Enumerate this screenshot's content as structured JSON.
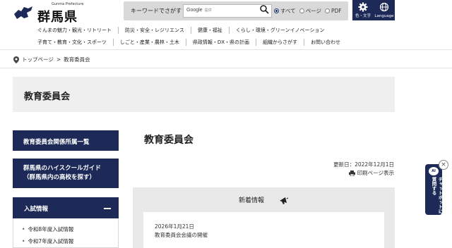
{
  "header": {
    "logo_en": "Gunma Prefecture",
    "logo_jp": "群馬県",
    "search_label": "キーワードでさがす",
    "search_brand": "Google",
    "search_brand_sub": "提供",
    "search_options": [
      "すべて",
      "ページ",
      "PDF"
    ],
    "search_selected": "すべて",
    "util_color_label": "色・文字",
    "util_lang_label": "Language"
  },
  "nav": {
    "row1": [
      "ぐんまの魅力・観光・リトリート",
      "防災・安全・レジリエンス",
      "健康・福祉",
      "くらし・環境・グリーンイノベーション"
    ],
    "row2": [
      "子育て・教育・文化・スポーツ",
      "しごと・産業・農林・土木",
      "県政情報・DX・県の計画",
      "組織からさがす",
      "お問い合わせ"
    ]
  },
  "breadcrumb": {
    "home": "トップページ",
    "separator": ">",
    "current": "教育委員会"
  },
  "title_band": "教育委員会",
  "sidebar": {
    "items": [
      {
        "label": "教育委員会関係所属一覧"
      },
      {
        "label_line1": "群馬県のハイスクールガイド",
        "label_line2": "（群馬県内の高校を探す）"
      },
      {
        "label": "入試情報"
      }
    ],
    "sublist": [
      "令和8年度入試情報",
      "令和7年度入試情報"
    ]
  },
  "main": {
    "title": "教育委員会",
    "updated": "更新日：2022年12月1日",
    "print_label": "印刷ページ表示"
  },
  "news": {
    "heading": "新着情報",
    "items": [
      {
        "date": "2026年1月21日",
        "text": "教育委員会会議の開催"
      }
    ]
  },
  "chatbot": {
    "badge": "AI",
    "label": "チャットボットに質問する",
    "close": "×"
  },
  "colors": {
    "navy": "#1d2a57",
    "band": "#efefef"
  }
}
